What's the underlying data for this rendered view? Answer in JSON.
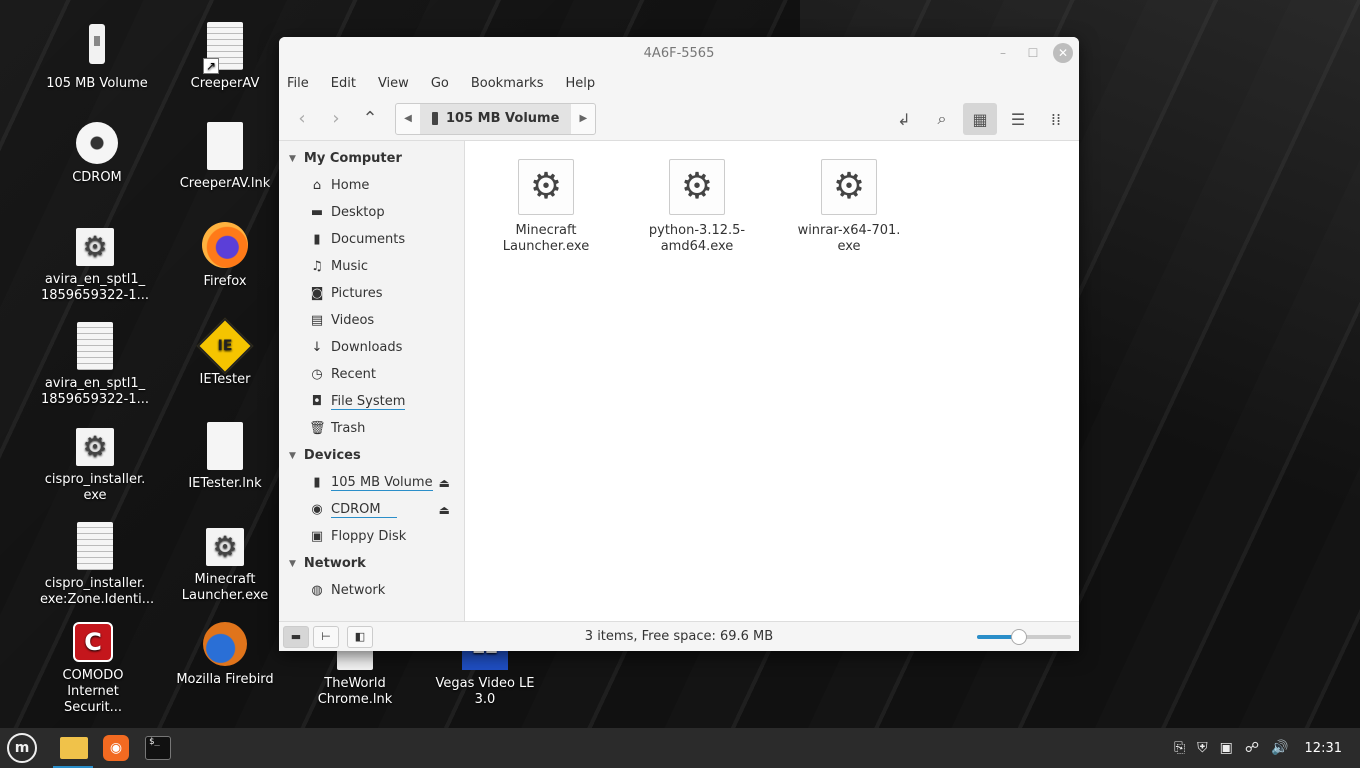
{
  "desktop_icons": [
    {
      "label": "105 MB Volume",
      "icon": "usb-drive-icon"
    },
    {
      "label": "CreeperAV",
      "icon": "shortcut-file-icon"
    },
    {
      "label": "CDROM",
      "icon": "cdrom-icon"
    },
    {
      "label": "CreeperAV.lnk",
      "icon": "file-icon"
    },
    {
      "label": "avira_en_sptl1_\n1859659322-1...",
      "icon": "executable-gear-icon"
    },
    {
      "label": "Firefox",
      "icon": "firefox-icon"
    },
    {
      "label": "avira_en_sptl1_\n1859659322-1...",
      "icon": "text-document-icon"
    },
    {
      "label": "IETester",
      "icon": "ietester-icon"
    },
    {
      "label": "cispro_installer.\nexe",
      "icon": "executable-gear-icon"
    },
    {
      "label": "IETester.lnk",
      "icon": "file-icon"
    },
    {
      "label": "cispro_installer.\nexe:Zone.Identi...",
      "icon": "text-document-icon"
    },
    {
      "label": "Minecraft\nLauncher.exe",
      "icon": "executable-gear-icon"
    },
    {
      "label": "COMODO\nInternet Securit...",
      "icon": "comodo-icon"
    },
    {
      "label": "Mozilla Firebird",
      "icon": "firebird-icon"
    },
    {
      "label": "TheWorld\nChrome.lnk",
      "icon": "file-icon"
    },
    {
      "label": "Vegas Video LE\n3.0",
      "icon": "vegas-icon"
    }
  ],
  "window": {
    "title": "4A6F-5565",
    "menu": [
      "File",
      "Edit",
      "View",
      "Go",
      "Bookmarks",
      "Help"
    ],
    "path": {
      "current": "105 MB Volume"
    },
    "sidebar": {
      "sections": [
        {
          "title": "My Computer",
          "items": [
            "Home",
            "Desktop",
            "Documents",
            "Music",
            "Pictures",
            "Videos",
            "Downloads",
            "Recent",
            "File System",
            "Trash"
          ]
        },
        {
          "title": "Devices",
          "items": [
            "105 MB Volume",
            "CDROM",
            "Floppy Disk"
          ]
        },
        {
          "title": "Network",
          "items": [
            "Network"
          ]
        }
      ]
    },
    "files": [
      {
        "name": "Minecraft\nLauncher.exe",
        "icon": "executable-gear-icon"
      },
      {
        "name": "python-3.12.5-\namd64.exe",
        "icon": "executable-gear-icon"
      },
      {
        "name": "winrar-x64-701.\nexe",
        "icon": "executable-gear-icon"
      }
    ],
    "status": "3 items, Free space: 69.6 MB",
    "zoom_level": 0.45
  },
  "panel": {
    "clock": "12:31"
  },
  "colors": {
    "accent": "#2a8ec9",
    "panel_bg": "#2b2b2b",
    "sidebar_bg": "#f3f3f3"
  }
}
